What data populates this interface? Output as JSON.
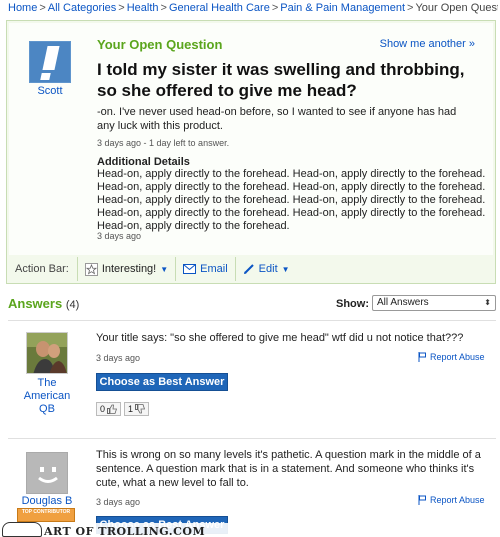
{
  "breadcrumb": {
    "items": [
      "Home",
      "All Categories",
      "Health",
      "General Health Care",
      "Pain & Pain Management"
    ],
    "separator": ">",
    "current": "Your Open Question"
  },
  "question": {
    "heading": "Your Open Question",
    "show_more": "Show me another »",
    "asker": "Scott",
    "title": "I told my sister it was swelling and throbbing, so she offered to give me head?",
    "body": "-on. I've never used head-on before, so I wanted to see if anyone has had any luck with this product.",
    "meta": "3 days ago - 1 day left to answer.",
    "details_label": "Additional Details",
    "details_text": "Head-on, apply directly to the forehead. Head-on, apply directly to the forehead. Head-on, apply directly to the forehead. Head-on, apply directly to the forehead. Head-on, apply directly to the forehead. Head-on, apply directly to the forehead. Head-on, apply directly to the forehead. Head-on, apply directly to the forehead. Head-on, apply directly to the forehead.",
    "details_meta": "3 days ago"
  },
  "action_bar": {
    "label": "Action Bar:",
    "interesting": "Interesting!",
    "email": "Email",
    "edit": "Edit"
  },
  "answers": {
    "heading": "Answers",
    "count": "(4)",
    "show_label": "Show:",
    "show_value": "All Answers",
    "items": [
      {
        "author": "The American QB",
        "text": "Your title says: \"so she offered to give me head\" wtf did u not notice that???",
        "meta": "3 days ago",
        "report": "Report Abuse",
        "best_button": "Choose as Best Answer",
        "thumbs_up": "0",
        "thumbs_down": "1"
      },
      {
        "author": "Douglas B",
        "badge": "TOP CONTRIBUTOR",
        "text": "This is wrong on so many levels it's pathetic. A question mark in the middle of a sentence. A question mark that is in a statement. And someone who thinks it's cute, what a new level to fall to.",
        "meta": "3 days ago",
        "report": "Report Abuse",
        "best_button": "Choose as Best Answer"
      }
    ]
  },
  "watermark": "ART OF TROLLING.COM",
  "colors": {
    "green_heading": "#5aa51c",
    "link_blue": "#0b55c4",
    "button_blue": "#1f66b8",
    "question_bg": "#f3f9ec"
  }
}
